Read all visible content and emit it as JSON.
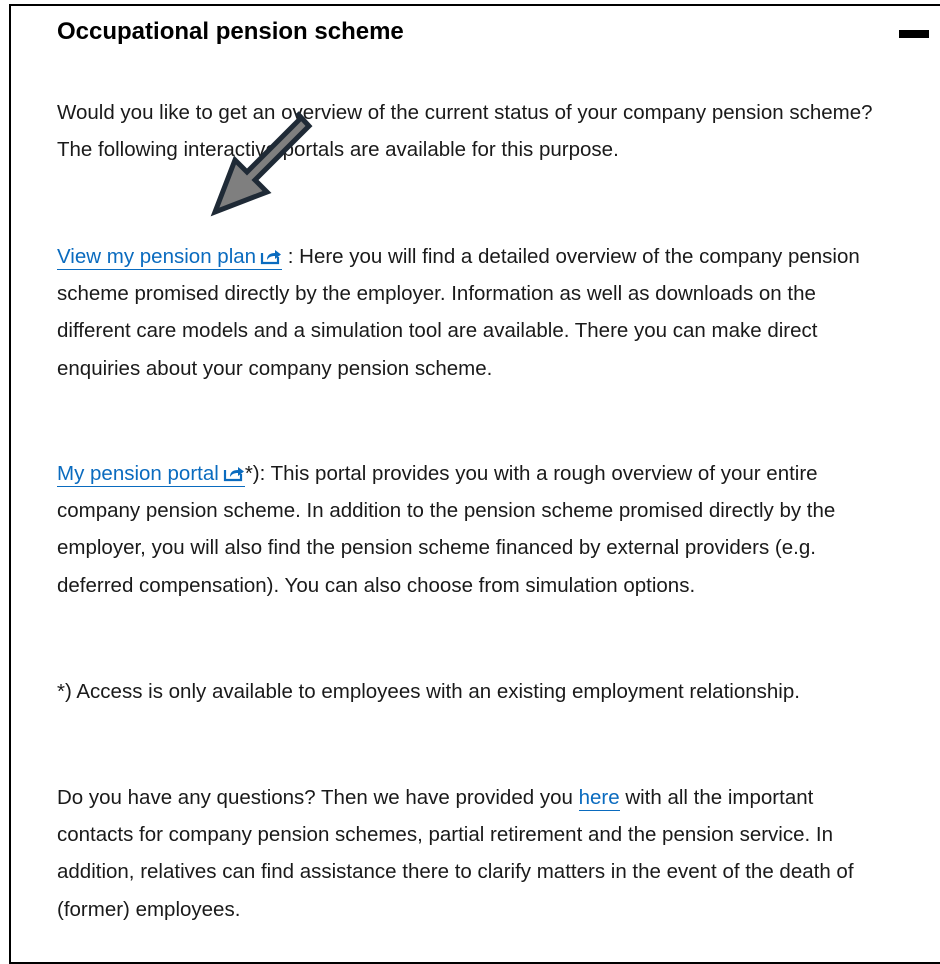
{
  "section": {
    "title": "Occupational pension scheme",
    "collapse_icon": "minus-icon"
  },
  "intro": {
    "text": "Would you like to get an overview of the current status of your company pension scheme? The following interactive portals are available for this purpose."
  },
  "pension_plan": {
    "link_label": "View my pension plan",
    "link_icon": "external-link-icon",
    "text": " : Here you will find a detailed overview of the company pension scheme promised directly by the employer. Information as well as downloads on the different care models and a simulation tool are available. There you can make direct enquiries about your company pension scheme."
  },
  "pension_portal": {
    "link_label": "My pension portal",
    "link_icon": "external-link-icon",
    "text": "*): This portal provides you with a rough overview of your entire company pension scheme. In addition to the pension scheme promised directly by the employer, you will also find the pension scheme financed by external providers (e.g. deferred compensation). You can also choose from simulation options."
  },
  "footnote": {
    "text": "*) Access is only available to employees with an existing employment relationship."
  },
  "questions": {
    "text_before": "Do you have any questions? Then we have provided you ",
    "link_label": "here",
    "text_after": " with all the important contacts for company pension schemes, partial retirement and the pension service. In addition, relatives can find assistance there to clarify matters in the event of the death of (former) employees."
  },
  "colors": {
    "link": "#0a6bbf",
    "text": "#1a1a1a",
    "arrow_fill": "#7f7f7f",
    "arrow_stroke": "#1f2a36"
  }
}
